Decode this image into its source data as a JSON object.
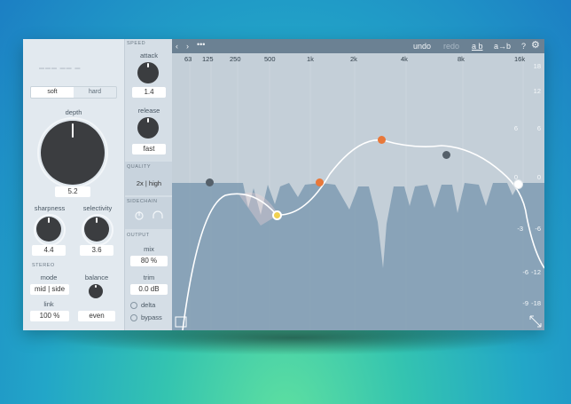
{
  "left": {
    "mode_toggle": {
      "soft": "soft",
      "hard": "hard"
    },
    "depth": {
      "label": "depth",
      "value": "5.2"
    },
    "sharpness": {
      "label": "sharpness",
      "value": "4.4"
    },
    "selectivity": {
      "label": "selectivity",
      "value": "3.6"
    },
    "stereo": {
      "section": "STEREO",
      "mode_label": "mode",
      "mode_value": "mid | side",
      "balance_label": "balance",
      "balance_value": "even",
      "link_label": "link",
      "link_value": "100 %"
    }
  },
  "mid": {
    "speed": {
      "section": "SPEED",
      "attack_label": "attack",
      "attack_value": "1.4",
      "release_label": "release",
      "release_value": "fast"
    },
    "quality": {
      "section": "QUALITY",
      "value": "2x | high"
    },
    "sidechain": {
      "section": "SIDECHAIN"
    },
    "output": {
      "section": "OUTPUT",
      "mix_label": "mix",
      "mix_value": "80 %",
      "trim_label": "trim",
      "trim_value": "0.0 dB",
      "delta": "delta",
      "bypass": "bypass"
    }
  },
  "toolbar": {
    "undo": "undo",
    "redo": "redo",
    "ab": "a b",
    "a_to_b": "a→b",
    "help": "?"
  },
  "graph": {
    "freq_labels": [
      "63",
      "125",
      "250",
      "500",
      "1k",
      "2k",
      "4k",
      "8k",
      "16k"
    ],
    "db_right": [
      "18",
      "12",
      "6",
      "0",
      "-6",
      "-12",
      "-18"
    ],
    "db_inner": [
      "6",
      "0",
      "-3",
      "-6",
      "-9"
    ]
  },
  "colors": {
    "accent_orange": "#e8783a",
    "node_yellow": "#f0d050",
    "node_gray": "#55606a",
    "toolbar": "#6b8193",
    "spectrum": "#7f9bb3"
  }
}
